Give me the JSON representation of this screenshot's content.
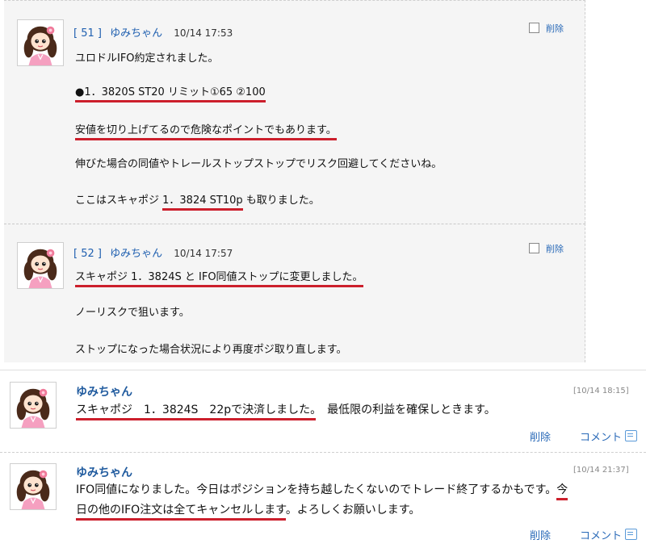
{
  "posts": [
    {
      "number": "[ 51 ]",
      "author": "ゆみちゃん",
      "timestamp": "10/14 17:53",
      "delete_label": "削除",
      "lines": [
        "ユロドルIFO約定されました。",
        "●1．3820S ST20 リミット①65 ②100",
        "安値を切り上げてるので危険なポイントでもあります。",
        "伸びた場合の同値やトレールストップストップでリスク回避してくださいね。",
        "ここはスキャポジ ",
        "1．3824 ST10p",
        " も取りました。"
      ]
    },
    {
      "number": "[ 52 ]",
      "author": "ゆみちゃん",
      "timestamp": "10/14 17:57",
      "delete_label": "削除",
      "lines": [
        "スキャポジ 1．3824S と IFO同値ストップに変更しました。",
        "ノーリスクで狙います。",
        "ストップになった場合状況により再度ポジ取り直します。"
      ]
    }
  ],
  "comments": [
    {
      "author": "ゆみちゃん",
      "date": "[10/14 18:15]",
      "text_underlined": "スキャポジ　1．3824S　22pで決済しました。",
      "text_rest": "　最低限の利益を確保しときます。",
      "delete_label": "削除",
      "comment_label": "コメント"
    },
    {
      "author": "ゆみちゃん",
      "date": "[10/14 21:37]",
      "line1_plain": "IFO同値になりました。今日はポジションを持ち越したくないのでトレード終了するかもです。",
      "line1_ul": "今",
      "line2_ul": "日の他のIFO注文は全てキャンセルします",
      "line2_rest": "。よろしくお願いします。",
      "delete_label": "削除",
      "comment_label": "コメント"
    }
  ],
  "colors": {
    "underline": "#cc1f2c",
    "link": "#2a6ab8",
    "author": "#1f5a9e",
    "panel_bg": "#f5f5f5"
  },
  "icons": [
    "avatar-image",
    "checkbox-icon",
    "comment-icon"
  ]
}
